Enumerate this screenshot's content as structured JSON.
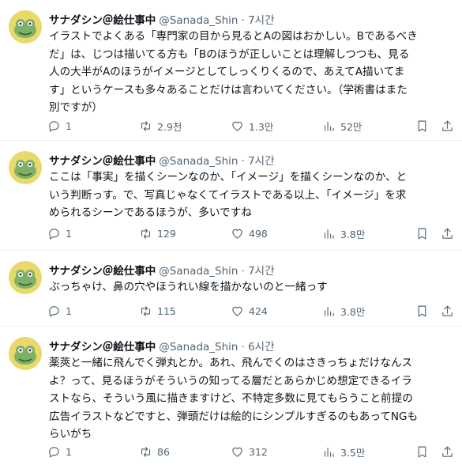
{
  "tweets": [
    {
      "name": "サナダシン＠絵仕事中",
      "handle": "@Sanada_Shin",
      "time": "· 7시간",
      "lines": [
        "イラストでよくある「専門家の目から見るとAの図はおかしい。Bであるべき",
        "だ」は、じつは描いてる方も「Bのほうが正しいことは理解しつつも、見る",
        "人の大半がAのほうがイメージとしてしっくりくるので、あえてA描いてま",
        "す」というケースも多々あることだけは言わいてください。（学術書はまた",
        "別ですが）"
      ],
      "replies": "1",
      "retweets": "2.9천",
      "likes": "1.3만",
      "views": "52만"
    },
    {
      "name": "サナダシン＠絵仕事中",
      "handle": "@Sanada_Shin",
      "time": "· 7시간",
      "lines": [
        "ここは「事実」を描くシーンなのか、「イメージ」を描くシーンなのか、と",
        "いう判断っす。で、写真じゃなくてイラストである以上、「イメージ」を求",
        "められるシーンであるほうが、多いですね"
      ],
      "replies": "1",
      "retweets": "129",
      "likes": "498",
      "views": "3.8만"
    },
    {
      "name": "サナダシン＠絵仕事中",
      "handle": "@Sanada_Shin",
      "time": "· 7시간",
      "lines": [
        "ぶっちゃけ、鼻の穴やほうれい線を描かないのと一緒っす"
      ],
      "replies": "1",
      "retweets": "115",
      "likes": "424",
      "views": "3.8만"
    },
    {
      "name": "サナダシン＠絵仕事中",
      "handle": "@Sanada_Shin",
      "time": "· 6시간",
      "lines": [
        "薬莢と一緒に飛んでく弾丸とか。あれ、飛んでくのはさきっちょだけなんス",
        "よ？って、見るほうがそういうの知ってる層だとあらかじめ想定できるイラ",
        "ストなら、そういう風に描きますけど、不特定多数に見てもらうこと前提の",
        "広告イラストなどですと、弾頭だけは絵的にシンプルすぎるのもあってNGも",
        "らいがち"
      ],
      "replies": "1",
      "retweets": "86",
      "likes": "312",
      "views": "3.5만"
    }
  ],
  "colors": {
    "text": "#0f1419",
    "muted": "#536471",
    "divider": "#eff3f4",
    "avatar_bg": "#e8d96a"
  },
  "icons": [
    "reply-icon",
    "retweet-icon",
    "like-icon",
    "views-icon",
    "bookmark-icon",
    "share-icon"
  ]
}
